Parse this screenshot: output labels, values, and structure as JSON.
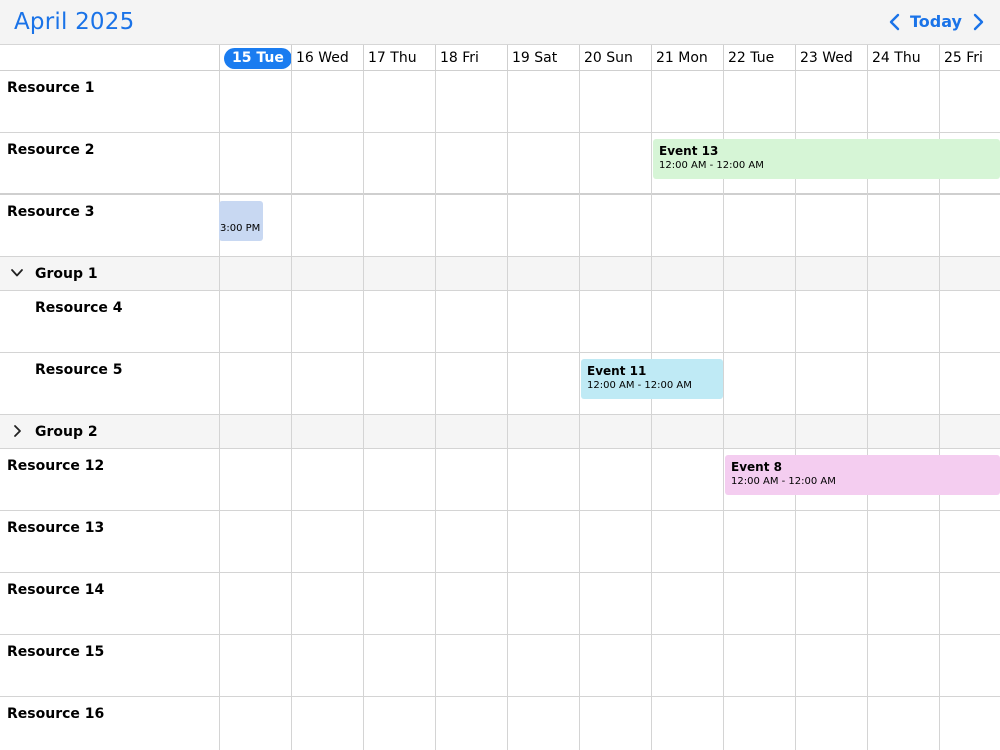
{
  "header": {
    "month_title": "April 2025",
    "today_label": "Today",
    "prev_icon": "chevron-left-icon",
    "next_icon": "chevron-right-icon",
    "accent_color": "#1a73e8"
  },
  "dates": [
    "15 Tue",
    "16 Wed",
    "17 Thu",
    "18 Fri",
    "19 Sat",
    "20 Sun",
    "21 Mon",
    "22 Tue",
    "23 Wed",
    "24 Thu",
    "25 Fri"
  ],
  "today_index": 0,
  "rows": [
    {
      "type": "resource",
      "label": "Resource 1"
    },
    {
      "type": "resource",
      "label": "Resource 2"
    },
    {
      "type": "resource",
      "label": "Resource 3"
    },
    {
      "type": "group",
      "label": "Group 1",
      "expanded": true
    },
    {
      "type": "resource",
      "label": "Resource 4"
    },
    {
      "type": "resource",
      "label": "Resource 5"
    },
    {
      "type": "group",
      "label": "Group 2",
      "expanded": false
    },
    {
      "type": "resource",
      "label": "Resource 12"
    },
    {
      "type": "resource",
      "label": "Resource 13"
    },
    {
      "type": "resource",
      "label": "Resource 14"
    },
    {
      "type": "resource",
      "label": "Resource 15"
    },
    {
      "type": "resource",
      "label": "Resource 16"
    }
  ],
  "events": [
    {
      "title": "Event 13",
      "time": "12:00 AM - 12:00 AM",
      "resource": "Resource 2",
      "start_date": "21 Mon",
      "color": "#d6f5d6"
    },
    {
      "title": "",
      "time": "3:00 PM",
      "resource": "Resource 3",
      "start_date": "15 Tue",
      "color": "#c8d8f2"
    },
    {
      "title": "Event 11",
      "time": "12:00 AM - 12:00 AM",
      "resource": "Resource 5",
      "start_date": "20 Sun",
      "end_date": "22 Tue",
      "color": "#bfeaf5"
    },
    {
      "title": "Event 8",
      "time": "12:00 AM - 12:00 AM",
      "resource": "Resource 12",
      "start_date": "22 Tue",
      "color": "#f4cdf0"
    }
  ]
}
